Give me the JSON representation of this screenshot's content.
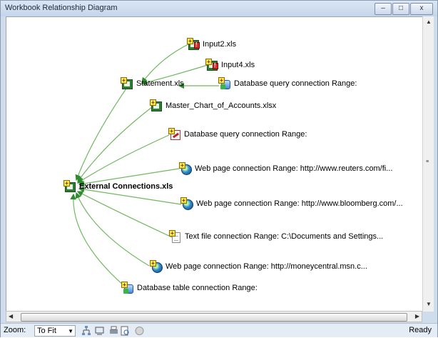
{
  "window": {
    "title": "Workbook Relationship Diagram"
  },
  "title_buttons": {
    "minimize": "–",
    "maximize": "□",
    "close": "x"
  },
  "diagram": {
    "nodes": [
      {
        "id": "input2",
        "label": "Input2.xls",
        "icon": "excel-warning-icon"
      },
      {
        "id": "input4",
        "label": "Input4.xls",
        "icon": "excel-warning-icon"
      },
      {
        "id": "statement",
        "label": "Statement.xls",
        "icon": "excel-icon"
      },
      {
        "id": "dbq1",
        "label": "Database query connection Range:",
        "icon": "database-connection-icon"
      },
      {
        "id": "master",
        "label": "Master_Chart_of_Accounts.xlsx",
        "icon": "excel-icon"
      },
      {
        "id": "dbq2",
        "label": "Database query connection Range:",
        "icon": "query-connection-icon"
      },
      {
        "id": "web1",
        "label": "Web page connection Range:  http://www.reuters.com/fi...",
        "icon": "globe-icon"
      },
      {
        "id": "root",
        "label": "External Connections.xls",
        "icon": "excel-icon"
      },
      {
        "id": "web2",
        "label": "Web page connection Range:  http://www.bloomberg.com/...",
        "icon": "globe-icon"
      },
      {
        "id": "txt",
        "label": "Text file connection Range:  C:\\Documents and Settings...",
        "icon": "text-file-icon"
      },
      {
        "id": "web3",
        "label": "Web page connection Range:  http://moneycentral.msn.c...",
        "icon": "globe-icon"
      },
      {
        "id": "dbt",
        "label": "Database table connection Range:",
        "icon": "database-connection-icon"
      }
    ]
  },
  "statusbar": {
    "zoom_label": "Zoom:",
    "zoom_value": "To Fit",
    "status": "Ready"
  },
  "colors": {
    "edge": "#6fb85e",
    "arrow": "#2e8b2e"
  }
}
